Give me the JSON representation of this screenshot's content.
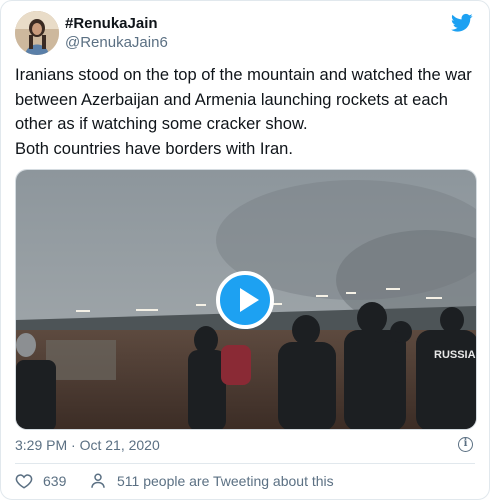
{
  "user": {
    "display_name": "#RenukaJain",
    "handle": "@RenukaJain6",
    "avatar_icon": "profile-photo"
  },
  "tweet": {
    "text_line1": "Iranians stood on the top of the mountain and watched the war between Azerbaijan and Armenia launching rockets at each other as if watching some cracker show.",
    "text_line2": "Both countries have borders with Iran.",
    "video_overlay_text": "RUSSIA"
  },
  "meta": {
    "timestamp": "3:29 PM · Oct 21, 2020",
    "info_icon": "i"
  },
  "actions": {
    "likes": "639",
    "people_tweeting": "511 people are Tweeting about this"
  },
  "colors": {
    "twitter_blue": "#1da1f2",
    "secondary_text": "#5b7083"
  }
}
